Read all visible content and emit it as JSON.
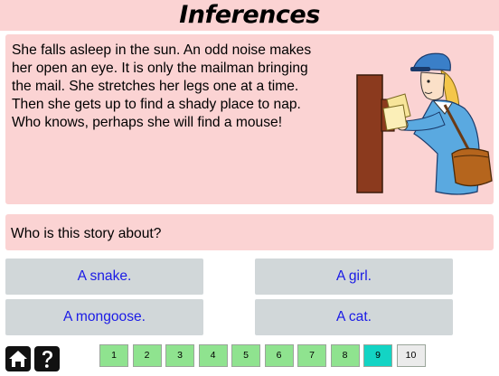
{
  "header": {
    "title": "Inferences"
  },
  "story": {
    "lines": [
      "She falls asleep in the sun. An odd noise makes",
      "her open an eye. It is only the mailman bringing",
      "the mail. She stretches her legs one at a time.",
      "Then she gets up to find a shady place to nap.",
      "Who knows, perhaps she will find a mouse!"
    ]
  },
  "question": {
    "text": "Who is this story about?"
  },
  "answers": [
    "A snake.",
    "A girl.",
    "A mongoose.",
    "A cat."
  ],
  "pager": {
    "pages": [
      "1",
      "2",
      "3",
      "4",
      "5",
      "6",
      "7",
      "8",
      "9",
      "10"
    ],
    "current_index": 8
  },
  "colors": {
    "panel": "#fbd3d3",
    "answer_bg": "#d1d7d9",
    "answer_text": "#1a1ae6",
    "page_done": "#8fe38f",
    "page_current": "#13d4c4"
  },
  "icons": {
    "home": "home-icon",
    "help": "question-mark-icon"
  }
}
